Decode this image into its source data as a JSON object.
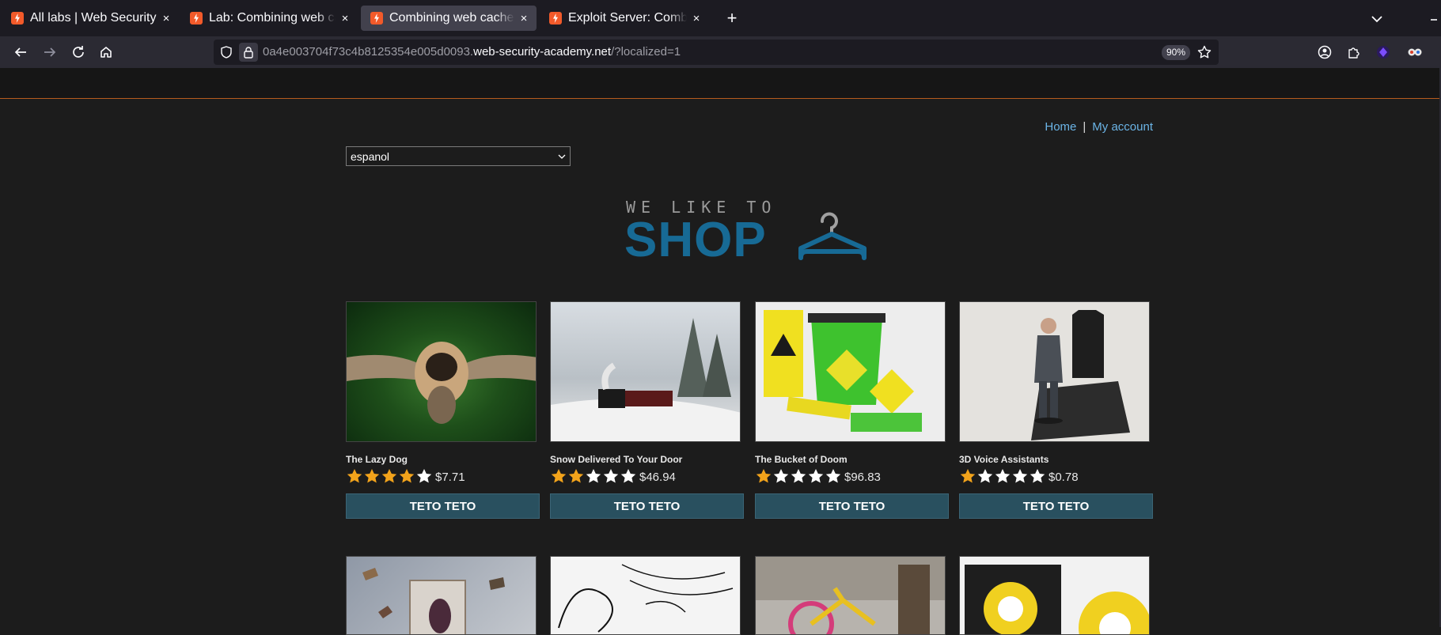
{
  "browser": {
    "tabs": [
      {
        "title": "All labs | Web Security Ac",
        "active": false
      },
      {
        "title": "Lab: Combining web cach",
        "active": false
      },
      {
        "title": "Combining web cache po",
        "active": true
      },
      {
        "title": "Exploit Server: Combinin",
        "active": false
      }
    ],
    "close_glyph": "×",
    "new_tab_glyph": "+",
    "url": {
      "prefix": "0a4e003704f73c4b8125354e005d0093.",
      "host": "web-security-academy.net",
      "path": "/?localized=1"
    },
    "zoom": "90%"
  },
  "page": {
    "nav": {
      "home": "Home",
      "separator": "|",
      "account": "My account"
    },
    "language_select": {
      "value": "espanol"
    },
    "logo": {
      "top": "WE LIKE TO",
      "main": "SHOP"
    },
    "products": [
      {
        "name": "The Lazy Dog",
        "rating": 4,
        "price": "$7.71",
        "button": "TETO TETO"
      },
      {
        "name": "Snow Delivered To Your Door",
        "rating": 2,
        "price": "$46.94",
        "button": "TETO TETO"
      },
      {
        "name": "The Bucket of Doom",
        "rating": 1,
        "price": "$96.83",
        "button": "TETO TETO"
      },
      {
        "name": "3D Voice Assistants",
        "rating": 1,
        "price": "$0.78",
        "button": "TETO TETO"
      }
    ]
  },
  "colors": {
    "star_filled": "#f2a31b",
    "star_empty": "#ffffff",
    "accent": "#176a95",
    "button": "#29505f"
  }
}
